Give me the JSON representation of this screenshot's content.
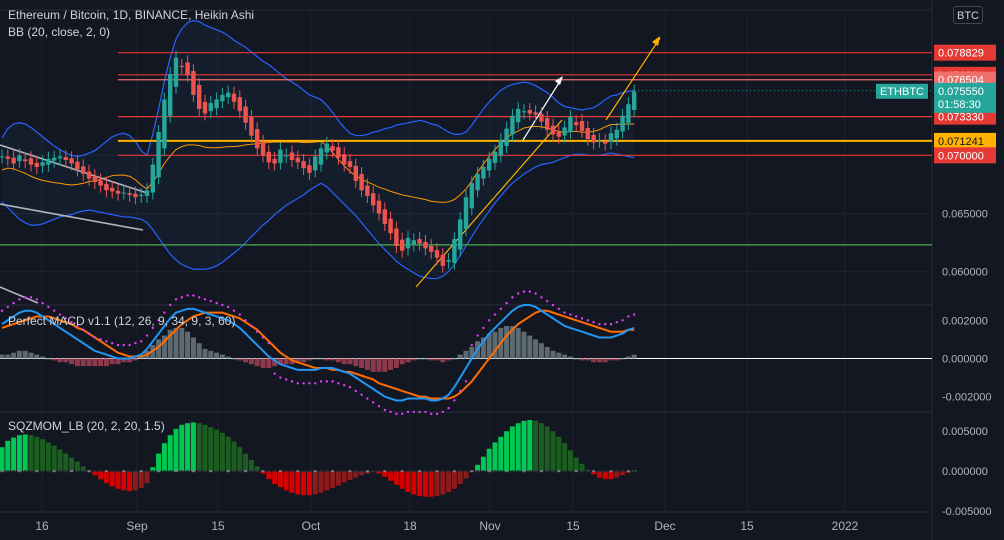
{
  "header": {
    "title": "Ethereum / Bitcoin, 1D, BINANCE, Heikin Ashi",
    "bb_label": "BB (20, close, 2, 0)",
    "macd_label": "Perfect MACD v1.1 (12, 26, 9, 34, 9, 3, 60)",
    "sqz_label": "SQZMOM_LB (20, 2, 20, 1.5)",
    "currency_button": "BTC"
  },
  "colors": {
    "background": "#131722",
    "up": "#26a69a",
    "down": "#ef5350",
    "red_line": "#e53935",
    "yellow_line": "#ffb300",
    "green_line": "#4caf50",
    "bb_band": "#2962ff",
    "bb_basis": "#ff9800",
    "macd_line": "#2196f3",
    "signal_line": "#ff6d00",
    "dots": "#e040fb"
  },
  "chart_data": [
    {
      "type": "candlestick",
      "title": "Ethereum / Bitcoin, 1D, BINANCE, Heikin Ashi",
      "symbol": "ETHBTC",
      "x_ticks": [
        "16",
        "Sep",
        "15",
        "Oct",
        "18",
        "Nov",
        "15",
        "Dec",
        "15",
        "2022"
      ],
      "y_ticks": [
        "0.060000",
        "0.065000",
        "0.070000"
      ],
      "ylim": [
        0.0573,
        0.0825
      ],
      "horizontal_levels": [
        {
          "value": 0.078829,
          "label": "0.078829",
          "color": "red"
        },
        {
          "value": 0.076924,
          "label": "0.076924",
          "color": "red"
        },
        {
          "value": 0.076504,
          "label": "0.076504",
          "color": "salmon"
        },
        {
          "value": 0.07333,
          "label": "0.073330",
          "color": "red"
        },
        {
          "value": 0.071241,
          "label": "0.071241",
          "color": "yellow"
        },
        {
          "value": 0.07,
          "label": "0.070000",
          "color": "red"
        },
        {
          "value": 0.0623,
          "label": "",
          "color": "green"
        }
      ],
      "last_price": {
        "symbol": "ETHBTC",
        "value": "0.075550",
        "countdown": "01:58:30"
      },
      "close": [
        0.0699,
        0.0697,
        0.0693,
        0.07,
        0.0695,
        0.0692,
        0.069,
        0.0694,
        0.0697,
        0.0698,
        0.0699,
        0.0696,
        0.0693,
        0.0688,
        0.0684,
        0.068,
        0.0677,
        0.0674,
        0.067,
        0.0669,
        0.0667,
        0.0668,
        0.0666,
        0.0664,
        0.0666,
        0.067,
        0.0692,
        0.072,
        0.0748,
        0.077,
        0.0784,
        0.0776,
        0.0769,
        0.0752,
        0.074,
        0.0736,
        0.0745,
        0.0748,
        0.0752,
        0.0754,
        0.0746,
        0.0738,
        0.0728,
        0.0717,
        0.0706,
        0.07,
        0.0694,
        0.0693,
        0.0705,
        0.07,
        0.0696,
        0.0694,
        0.0689,
        0.0685,
        0.0699,
        0.0706,
        0.071,
        0.0704,
        0.0698,
        0.0692,
        0.069,
        0.0678,
        0.067,
        0.0665,
        0.0657,
        0.065,
        0.0641,
        0.0633,
        0.0622,
        0.0618,
        0.0629,
        0.0627,
        0.0624,
        0.062,
        0.0617,
        0.0612,
        0.0605,
        0.061,
        0.0628,
        0.0645,
        0.0664,
        0.0676,
        0.0684,
        0.069,
        0.0697,
        0.0703,
        0.0713,
        0.0723,
        0.0734,
        0.074,
        0.0738,
        0.0736,
        0.0735,
        0.0729,
        0.0722,
        0.0718,
        0.0716,
        0.0724,
        0.0733,
        0.0726,
        0.0721,
        0.0714,
        0.0711,
        0.0713,
        0.071,
        0.0719,
        0.0722,
        0.0734,
        0.0744,
        0.0755
      ],
      "bb_upper": [
        0.0715,
        0.0723,
        0.0727,
        0.0728,
        0.0727,
        0.0724,
        0.072,
        0.0716,
        0.0712,
        0.0708,
        0.0705,
        0.0702,
        0.07,
        0.0699,
        0.07,
        0.0702,
        0.0704,
        0.0708,
        0.0712,
        0.0716,
        0.0718,
        0.0719,
        0.0717,
        0.0712,
        0.0704,
        0.07,
        0.0718,
        0.074,
        0.0764,
        0.0784,
        0.08,
        0.0809,
        0.0814,
        0.0816,
        0.0815,
        0.0812,
        0.081,
        0.0808,
        0.0806,
        0.0803,
        0.0799,
        0.0796,
        0.0793,
        0.0789,
        0.0785,
        0.0781,
        0.0778,
        0.0774,
        0.077,
        0.0766,
        0.0763,
        0.076,
        0.0756,
        0.0752,
        0.075,
        0.0748,
        0.0743,
        0.0737,
        0.073,
        0.0724,
        0.0719,
        0.0717,
        0.0717,
        0.0718,
        0.072,
        0.0721,
        0.0723,
        0.0724,
        0.0726,
        0.0727,
        0.0728,
        0.0729,
        0.073,
        0.0729,
        0.0727,
        0.0726,
        0.0723,
        0.072,
        0.0718,
        0.0718,
        0.072,
        0.0726,
        0.0733,
        0.074,
        0.0746,
        0.0751,
        0.0756,
        0.0759,
        0.0761,
        0.0762,
        0.0763,
        0.0762,
        0.076,
        0.0757,
        0.0754,
        0.075,
        0.0745,
        0.0742,
        0.0741,
        0.074,
        0.0739,
        0.074,
        0.0741,
        0.0744,
        0.0748,
        0.0751,
        0.0752,
        0.0754,
        0.0755,
        0.0756
      ],
      "bb_lower": [
        0.066,
        0.0655,
        0.065,
        0.0645,
        0.0642,
        0.064,
        0.064,
        0.0641,
        0.0643,
        0.0645,
        0.0647,
        0.0648,
        0.0649,
        0.0651,
        0.0652,
        0.0653,
        0.0652,
        0.0651,
        0.065,
        0.0649,
        0.0648,
        0.0647,
        0.0647,
        0.0646,
        0.0645,
        0.0642,
        0.0636,
        0.0629,
        0.0622,
        0.0615,
        0.061,
        0.0606,
        0.0604,
        0.0602,
        0.0602,
        0.0602,
        0.0603,
        0.0605,
        0.0608,
        0.0612,
        0.0616,
        0.062,
        0.0625,
        0.063,
        0.0635,
        0.064,
        0.0644,
        0.0649,
        0.0653,
        0.0657,
        0.066,
        0.0663,
        0.0666,
        0.067,
        0.0673,
        0.0676,
        0.0673,
        0.0668,
        0.0663,
        0.0658,
        0.0653,
        0.0648,
        0.0642,
        0.0636,
        0.063,
        0.0624,
        0.0619,
        0.0614,
        0.0609,
        0.0605,
        0.0602,
        0.0599,
        0.0596,
        0.0595,
        0.0594,
        0.0594,
        0.0596,
        0.06,
        0.0606,
        0.0614,
        0.0622,
        0.063,
        0.0638,
        0.0645,
        0.0652,
        0.0659,
        0.0665,
        0.0671,
        0.0676,
        0.068,
        0.0684,
        0.0687,
        0.069,
        0.0692,
        0.0693,
        0.0694,
        0.0696,
        0.0698,
        0.07,
        0.0701,
        0.0701,
        0.07,
        0.07,
        0.07,
        0.0701,
        0.0702,
        0.0701,
        0.07,
        0.0699,
        0.0698
      ]
    },
    {
      "type": "bar_line",
      "title": "Perfect MACD v1.1 (12, 26, 9, 34, 9, 3, 60)",
      "y_ticks": [
        "-0.002000",
        "0.000000",
        "0.002000"
      ],
      "ylim": [
        -0.0027,
        0.0028
      ],
      "histogram": [
        0.0002,
        0.0002,
        0.0003,
        0.0004,
        0.0004,
        0.0003,
        0.0002,
        0.0001,
        0.0,
        -0.0001,
        -0.0002,
        -0.0002,
        -0.0003,
        -0.0004,
        -0.0004,
        -0.0004,
        -0.0004,
        -0.0004,
        -0.0004,
        -0.0003,
        -0.0003,
        -0.0002,
        -0.0002,
        -0.0001,
        0.0001,
        0.0004,
        0.0007,
        0.001,
        0.0012,
        0.0015,
        0.0016,
        0.0016,
        0.0014,
        0.0011,
        0.0008,
        0.0005,
        0.0004,
        0.0003,
        0.0002,
        0.0001,
        0.0,
        -0.0001,
        -0.0002,
        -0.0003,
        -0.0004,
        -0.0005,
        -0.0005,
        -0.0004,
        -0.0003,
        -0.0003,
        -0.0003,
        -0.0002,
        -0.0002,
        -0.0001,
        0.0,
        0.0,
        -0.0001,
        -0.0001,
        -0.0002,
        -0.0003,
        -0.0003,
        -0.0004,
        -0.0005,
        -0.0006,
        -0.0007,
        -0.0007,
        -0.0007,
        -0.0006,
        -0.0005,
        -0.0003,
        -0.0002,
        -0.0001,
        0.0,
        0.0,
        -0.0001,
        -0.0001,
        -0.0002,
        -0.0001,
        0.0,
        0.0002,
        0.0004,
        0.0006,
        0.0009,
        0.0011,
        0.0013,
        0.0014,
        0.0016,
        0.0017,
        0.0017,
        0.0016,
        0.0014,
        0.0012,
        0.001,
        0.0008,
        0.0006,
        0.0004,
        0.0003,
        0.0002,
        0.0001,
        0.0,
        -0.0001,
        -0.0001,
        -0.0002,
        -0.0002,
        -0.0002,
        -0.0001,
        -0.0001,
        0.0,
        0.0001,
        0.0002
      ],
      "macd": [
        0.0018,
        0.002,
        0.0022,
        0.0024,
        0.0025,
        0.0025,
        0.0024,
        0.0022,
        0.002,
        0.0018,
        0.0016,
        0.0014,
        0.0012,
        0.001,
        0.0008,
        0.0006,
        0.0004,
        0.0003,
        0.0002,
        0.0001,
        0.0,
        0.0,
        0.0,
        0.0001,
        0.0002,
        0.0005,
        0.0009,
        0.0013,
        0.0017,
        0.0021,
        0.0024,
        0.0025,
        0.0026,
        0.0026,
        0.0025,
        0.0024,
        0.0023,
        0.0022,
        0.0021,
        0.002,
        0.0018,
        0.0016,
        0.0013,
        0.001,
        0.0007,
        0.0004,
        0.0001,
        -0.0001,
        -0.0003,
        -0.0004,
        -0.0005,
        -0.0006,
        -0.0006,
        -0.0006,
        -0.0006,
        -0.0005,
        -0.0005,
        -0.0005,
        -0.0006,
        -0.0007,
        -0.0008,
        -0.001,
        -0.0012,
        -0.0014,
        -0.0016,
        -0.0018,
        -0.002,
        -0.0021,
        -0.0022,
        -0.0022,
        -0.0021,
        -0.0021,
        -0.0021,
        -0.0021,
        -0.0022,
        -0.0022,
        -0.0021,
        -0.0019,
        -0.0015,
        -0.001,
        -0.0005,
        0.0,
        0.0005,
        0.0009,
        0.0013,
        0.0016,
        0.0019,
        0.0022,
        0.0025,
        0.0027,
        0.0028,
        0.0028,
        0.0027,
        0.0025,
        0.0023,
        0.0021,
        0.0019,
        0.0017,
        0.0016,
        0.0015,
        0.0014,
        0.0013,
        0.0012,
        0.0011,
        0.0011,
        0.0011,
        0.0012,
        0.0013,
        0.0015,
        0.0016
      ],
      "signal": [
        0.0016,
        0.0017,
        0.0018,
        0.0019,
        0.002,
        0.0021,
        0.0022,
        0.0022,
        0.0022,
        0.0021,
        0.002,
        0.0019,
        0.0018,
        0.0016,
        0.0015,
        0.0013,
        0.0011,
        0.0009,
        0.0007,
        0.0005,
        0.0003,
        0.0002,
        0.0001,
        0.0001,
        0.0001,
        0.0002,
        0.0004,
        0.0006,
        0.0009,
        0.0012,
        0.0015,
        0.0018,
        0.002,
        0.0022,
        0.0023,
        0.0024,
        0.0024,
        0.0024,
        0.0024,
        0.0023,
        0.0022,
        0.0021,
        0.0019,
        0.0017,
        0.0015,
        0.0012,
        0.0009,
        0.0006,
        0.0003,
        0.0001,
        -0.0001,
        -0.0002,
        -0.0003,
        -0.0004,
        -0.0005,
        -0.0005,
        -0.0005,
        -0.0006,
        -0.0006,
        -0.0007,
        -0.0007,
        -0.0008,
        -0.0009,
        -0.001,
        -0.0011,
        -0.0013,
        -0.0014,
        -0.0015,
        -0.0016,
        -0.0017,
        -0.0018,
        -0.0019,
        -0.002,
        -0.002,
        -0.0021,
        -0.0021,
        -0.0021,
        -0.0021,
        -0.002,
        -0.0018,
        -0.0015,
        -0.0012,
        -0.0008,
        -0.0004,
        0.0,
        0.0004,
        0.0008,
        0.0012,
        0.0015,
        0.0018,
        0.002,
        0.0022,
        0.0024,
        0.0025,
        0.0025,
        0.0024,
        0.0023,
        0.0022,
        0.0021,
        0.002,
        0.0019,
        0.0018,
        0.0017,
        0.0016,
        0.0015,
        0.0014,
        0.0014,
        0.0014,
        0.0015,
        0.0015
      ]
    },
    {
      "type": "bar",
      "title": "SQZMOM_LB (20, 2, 20, 1.5)",
      "y_ticks": [
        "-0.005000",
        "0.000000",
        "0.005000"
      ],
      "ylim": [
        -0.0051,
        0.0074
      ],
      "values": [
        0.003,
        0.0038,
        0.0042,
        0.0045,
        0.0046,
        0.0045,
        0.0043,
        0.004,
        0.0036,
        0.0032,
        0.0027,
        0.0022,
        0.0017,
        0.0012,
        0.0006,
        0.0001,
        -0.0005,
        -0.001,
        -0.0015,
        -0.0019,
        -0.0022,
        -0.0024,
        -0.0025,
        -0.0024,
        -0.0021,
        -0.0015,
        0.0005,
        0.0022,
        0.0035,
        0.0045,
        0.0053,
        0.0058,
        0.006,
        0.0061,
        0.006,
        0.0058,
        0.0055,
        0.0052,
        0.0048,
        0.0043,
        0.0037,
        0.003,
        0.0022,
        0.0014,
        0.0006,
        -0.0003,
        -0.001,
        -0.0016,
        -0.002,
        -0.0024,
        -0.0027,
        -0.0029,
        -0.003,
        -0.003,
        -0.0029,
        -0.0027,
        -0.0024,
        -0.0021,
        -0.0018,
        -0.0014,
        -0.0011,
        -0.0008,
        -0.0005,
        -0.0003,
        -0.0001,
        -0.0003,
        -0.0007,
        -0.0012,
        -0.0017,
        -0.0022,
        -0.0026,
        -0.0029,
        -0.0031,
        -0.0032,
        -0.0032,
        -0.0031,
        -0.0029,
        -0.0026,
        -0.0022,
        -0.0016,
        -0.0009,
        -0.0001,
        0.0008,
        0.0018,
        0.0028,
        0.0036,
        0.0043,
        0.005,
        0.0056,
        0.006,
        0.0063,
        0.0064,
        0.0063,
        0.006,
        0.0056,
        0.005,
        0.0043,
        0.0035,
        0.0026,
        0.0017,
        0.0009,
        0.0002,
        -0.0004,
        -0.0008,
        -0.001,
        -0.001,
        -0.0008,
        -0.0005,
        -0.0002,
        0.0001
      ]
    }
  ]
}
